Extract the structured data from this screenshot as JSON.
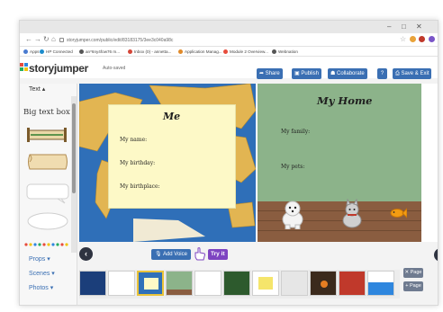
{
  "browser": {
    "url": "storyjumper.com/public/edit/83183175/3ee3c040a98c",
    "bookmarks": [
      "Apps",
      "HP Connected",
      "an*6ny4fow76 m...",
      "Inbox (0) - annetta...",
      "Application Manag...",
      "Module 2 Overview...",
      "Webnation"
    ]
  },
  "app": {
    "logo": "storyjumper",
    "autosaved": "Auto-saved",
    "toolbar": {
      "share": "Share",
      "publish": "Publish",
      "collaborate": "Collaborate",
      "help": "?",
      "save_exit": "Save & Exit"
    }
  },
  "sidebar": {
    "header": "Text",
    "big_text_box": "Big text box",
    "menu": [
      "Props",
      "Scenes",
      "Photos"
    ]
  },
  "pages": {
    "left": {
      "title": "Me",
      "fields": [
        "My name:",
        "My birthday:",
        "My birthplace:"
      ]
    },
    "right": {
      "title": "My Home",
      "fields": [
        "My family:",
        "My pets:"
      ]
    }
  },
  "controls": {
    "add_voice": "Add Voice",
    "try_it": "Try it",
    "page_add": "Page",
    "page_remove": "Page"
  },
  "icons": {
    "prev": "chevron-left-icon",
    "next": "chevron-right-icon",
    "hand": "pointing-hand-icon"
  },
  "colors": {
    "brand_blue": "#3a6fb3",
    "try_it_purple": "#7e44c1",
    "card_yellow": "#fdf9c7",
    "right_page_green": "#8cb38a"
  }
}
